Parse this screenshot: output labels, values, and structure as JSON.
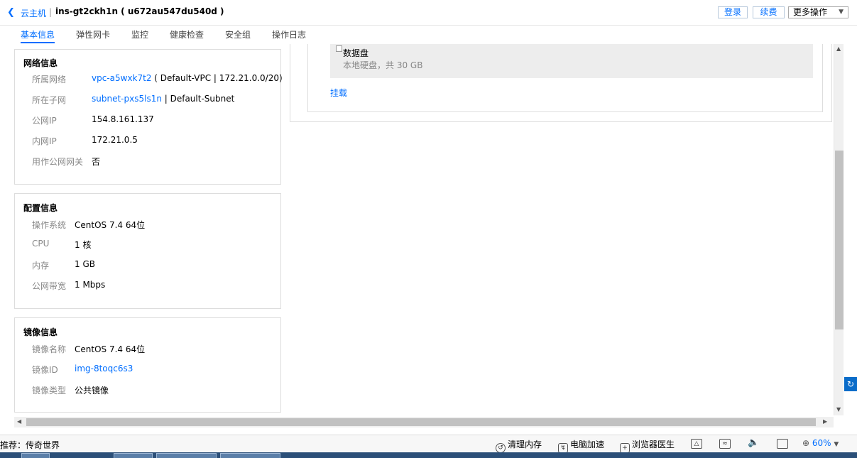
{
  "header": {
    "breadcrumb": "云主机",
    "separator": "|",
    "instance_title": "ins-gt2ckh1n ( u672au547du540d )",
    "buttons": {
      "login": "登录",
      "renew": "续费",
      "more": "更多操作"
    }
  },
  "tabs": [
    {
      "label": "基本信息",
      "active": true
    },
    {
      "label": "弹性网卡"
    },
    {
      "label": "监控"
    },
    {
      "label": "健康检查"
    },
    {
      "label": "安全组"
    },
    {
      "label": "操作日志"
    }
  ],
  "network": {
    "title": "网络信息",
    "rows": [
      {
        "label": "所属网络",
        "link": "vpc-a5wxk7t2",
        "value": " ( Default-VPC | 172.21.0.0/20)"
      },
      {
        "label": "所在子网",
        "link": "subnet-pxs5ls1n",
        "value": " | Default-Subnet"
      },
      {
        "label": "公网IP",
        "value": "154.8.161.137"
      },
      {
        "label": "内网IP",
        "value": "172.21.0.5"
      },
      {
        "label": "用作公网网关",
        "value": "否"
      }
    ]
  },
  "config": {
    "title": "配置信息",
    "rows": [
      {
        "label": "操作系统",
        "value": "CentOS 7.4 64位"
      },
      {
        "label": "CPU",
        "value": "1 核"
      },
      {
        "label": "内存",
        "value": "1 GB"
      },
      {
        "label": "公网带宽",
        "value": "1 Mbps"
      }
    ]
  },
  "image": {
    "title": "镜像信息",
    "rows": [
      {
        "label": "镜像名称",
        "value": "CentOS 7.4 64位"
      },
      {
        "label": "镜像ID",
        "link": "img-8toqc6s3"
      },
      {
        "label": "镜像类型",
        "value": "公共镜像"
      }
    ]
  },
  "disk": {
    "name": "数据盘",
    "desc": "本地硬盘，共 30 GB",
    "mount_label": "挂载"
  },
  "statusbar": {
    "recommend": "推荐：传奇世界",
    "clean_memory": "清理内存",
    "pc_accelerate": "电脑加速",
    "browser_doctor": "浏览器医生",
    "zoom": "60%"
  },
  "colors": {
    "accent": "#006eff",
    "label_gray": "#888888"
  }
}
